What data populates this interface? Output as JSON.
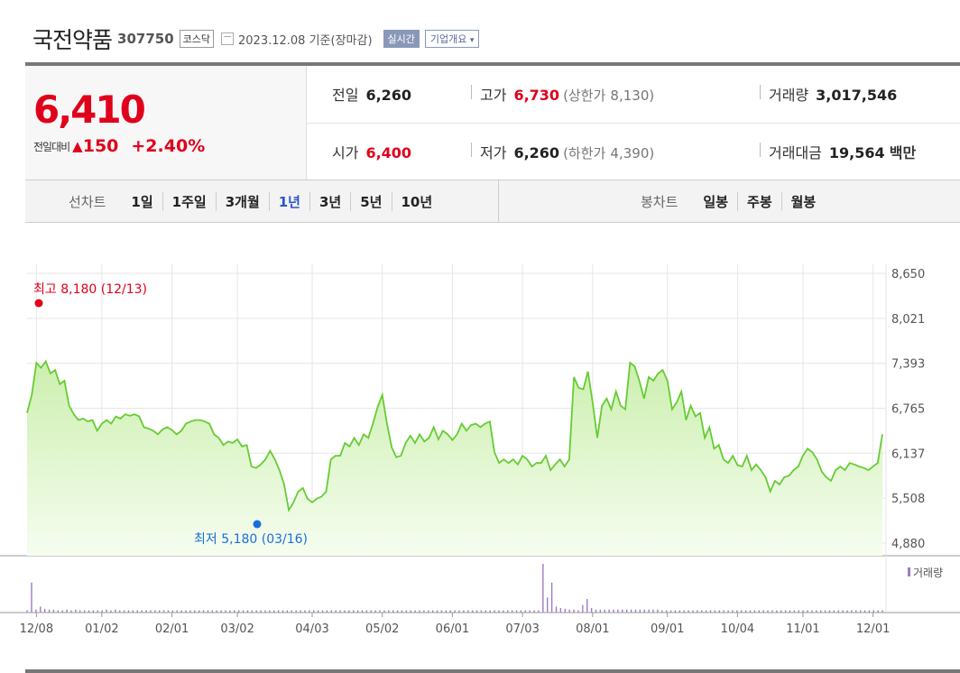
{
  "header": {
    "name": "국전약품",
    "code": "307750",
    "market": "코스닥",
    "date_text": "2023.12.08  기준(장마감)",
    "realtime_btn": "실시간",
    "company_btn": "기업개요"
  },
  "price": {
    "current": "6,410",
    "change_label": "전일대비",
    "change_arrow": "▲",
    "change_value": "150",
    "change_pct": "+2.40%"
  },
  "stats": {
    "prev_label": "전일",
    "prev_value": "6,260",
    "high_label": "고가",
    "high_value": "6,730",
    "upper_label": "(상한가",
    "upper_value": "8,130)",
    "volume_label": "거래량",
    "volume_value": "3,017,546",
    "open_label": "시가",
    "open_value": "6,400",
    "low_label": "저가",
    "low_value": "6,260",
    "lower_label": "(하한가",
    "lower_value": "4,390)",
    "amount_label": "거래대금",
    "amount_value": "19,564",
    "amount_unit": "백만"
  },
  "tabs": {
    "line_label": "선차트",
    "line_items": [
      "1일",
      "1주일",
      "3개월",
      "1년",
      "3년",
      "5년",
      "10년"
    ],
    "line_selected": 3,
    "candle_label": "봉차트",
    "candle_items": [
      "일봉",
      "주봉",
      "월봉"
    ]
  },
  "colors": {
    "up": "#e0001b",
    "line": "#66cc33",
    "fill": "#e6f7d6",
    "low_marker": "#1a6fd8",
    "volume": "#9b7bc9"
  },
  "chart_data": {
    "type": "area",
    "title": "",
    "ylim": [
      4880,
      8650
    ],
    "y_ticks": [
      "8,650",
      "8,021",
      "7,393",
      "6,765",
      "6,137",
      "5,508",
      "4,880"
    ],
    "x_ticks": [
      "12/08",
      "01/02",
      "02/01",
      "03/02",
      "04/03",
      "05/02",
      "06/01",
      "07/03",
      "08/01",
      "09/01",
      "10/04",
      "11/01",
      "12/01"
    ],
    "max_label": "최고 8,180 (12/13)",
    "min_label": "최저 5,180 (03/16)",
    "max_value": 8180,
    "min_value": 5180,
    "volume_legend": "거래량",
    "series": [
      {
        "values": [
          6700,
          6950,
          7400,
          7330,
          7420,
          7250,
          7300,
          7100,
          7150,
          6800,
          6680,
          6600,
          6620,
          6580,
          6600,
          6450,
          6550,
          6600,
          6550,
          6650,
          6620,
          6680,
          6660,
          6680,
          6650,
          6500,
          6480,
          6450,
          6400,
          6470,
          6500,
          6460,
          6400,
          6450,
          6550,
          6580,
          6600,
          6600,
          6580,
          6550,
          6400,
          6350,
          6250,
          6300,
          6280,
          6330,
          6230,
          6250,
          5950,
          5930,
          5980,
          6050,
          6170,
          6050,
          5900,
          5700,
          5340,
          5450,
          5600,
          5650,
          5500,
          5450,
          5500,
          5530,
          5600,
          6050,
          6100,
          6100,
          6280,
          6230,
          6350,
          6250,
          6400,
          6350,
          6550,
          6780,
          6950,
          6550,
          6220,
          6080,
          6100,
          6280,
          6380,
          6280,
          6400,
          6300,
          6350,
          6500,
          6330,
          6450,
          6400,
          6320,
          6400,
          6550,
          6450,
          6530,
          6550,
          6500,
          6550,
          6580,
          6150,
          6000,
          6050,
          6000,
          6050,
          5980,
          6100,
          6050,
          5950,
          6000,
          6000,
          6100,
          5900,
          5980,
          6050,
          5950,
          6050,
          7200,
          7050,
          7030,
          7280,
          6850,
          6350,
          6800,
          6900,
          6750,
          7000,
          6800,
          6750,
          7400,
          7350,
          7150,
          6900,
          7200,
          7150,
          7250,
          7300,
          7150,
          6750,
          6850,
          7000,
          6600,
          6800,
          6650,
          6700,
          6350,
          6500,
          6200,
          6250,
          6050,
          6000,
          6100,
          5970,
          5950,
          6100,
          5900,
          5980,
          5900,
          5800,
          5600,
          5750,
          5700,
          5800,
          5820,
          5900,
          5950,
          6100,
          6200,
          6150,
          6050,
          5880,
          5800,
          5750,
          5900,
          5950,
          5900,
          6000,
          5980,
          5950,
          5930,
          5900,
          5950,
          6000,
          6400
        ]
      }
    ],
    "volume": [
      3,
      40,
      4,
      8,
      5,
      4,
      4,
      3,
      3,
      4,
      3,
      4,
      3,
      3,
      3,
      3,
      3,
      3,
      4,
      3,
      4,
      3,
      3,
      3,
      3,
      3,
      3,
      3,
      3,
      3,
      3,
      3,
      3,
      3,
      3,
      3,
      3,
      3,
      3,
      3,
      3,
      3,
      3,
      3,
      3,
      3,
      3,
      3,
      3,
      3,
      3,
      3,
      3,
      3,
      3,
      3,
      3,
      3,
      3,
      3,
      3,
      3,
      3,
      3,
      3,
      3,
      3,
      3,
      3,
      3,
      3,
      3,
      3,
      3,
      3,
      3,
      3,
      3,
      3,
      3,
      3,
      3,
      3,
      3,
      3,
      3,
      3,
      3,
      3,
      3,
      3,
      3,
      3,
      3,
      3,
      3,
      3,
      3,
      3,
      3,
      3,
      3,
      3,
      3,
      3,
      3,
      3,
      3,
      3,
      3,
      3,
      3,
      3,
      3,
      3,
      3,
      3,
      65,
      20,
      40,
      8,
      6,
      5,
      4,
      4,
      3,
      10,
      18,
      6,
      4,
      4,
      4,
      4,
      4,
      4,
      4,
      4,
      4,
      4,
      4,
      4,
      4,
      4,
      4,
      3,
      3,
      3,
      3,
      3,
      3,
      3,
      3,
      3,
      3,
      3,
      3,
      3,
      3,
      3,
      3,
      3,
      3,
      3,
      3,
      3,
      3,
      3,
      3,
      3,
      3,
      3,
      3,
      3,
      3,
      3,
      3,
      3,
      3,
      3,
      3,
      3,
      3,
      3,
      3,
      3,
      3,
      3,
      3,
      3,
      3,
      3,
      3,
      3,
      3,
      3
    ]
  }
}
